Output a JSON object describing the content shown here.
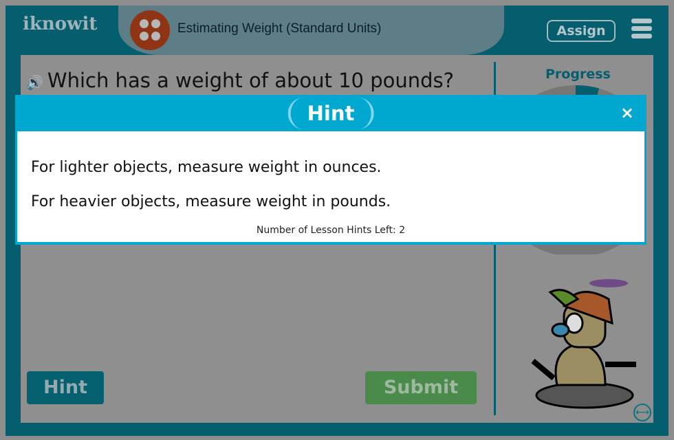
{
  "header": {
    "logo": "iknowit",
    "lesson_title": "Estimating Weight (Standard Units)",
    "assign_label": "Assign"
  },
  "question": {
    "text": "Which has a weight of about 10 pounds?"
  },
  "sidebar": {
    "progress_label": "Progress"
  },
  "buttons": {
    "hint": "Hint",
    "submit": "Submit"
  },
  "modal": {
    "title": "Hint",
    "close": "×",
    "lines": [
      "For lighter objects, measure weight in ounces.",
      "For heavier objects, measure weight in pounds."
    ],
    "hints_left": "Number of Lesson Hints Left: 2"
  },
  "colors": {
    "frame": "#045e6e",
    "modal": "#00a8d0",
    "submit": "#4a8a4b"
  }
}
